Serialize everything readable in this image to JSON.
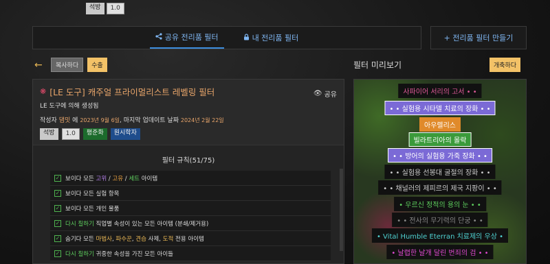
{
  "top_badges": [
    "석방",
    "1.0"
  ],
  "tabs": [
    {
      "icon": "share-icon",
      "glyph": "<",
      "label": "공유 전리품 필터"
    },
    {
      "icon": "lock-icon",
      "glyph": "🔒",
      "label": "내 전리품 필터"
    }
  ],
  "make_filter_label": "+ 전리품 필터 만들기",
  "toolbar": {
    "back_glyph": "←",
    "copy_label": "복사하다",
    "export_label": "수출"
  },
  "preview": {
    "title": "필터 미리보기",
    "collapse_label": "개축하다"
  },
  "filter": {
    "icon_glyph": "❋",
    "title": "[LE 도구] 캐주얼 프라이멀리스트 레벨링 필터",
    "share_glyph": "👁",
    "share_label": "공유",
    "subtitle": "LE 도구에 의해 생성됨",
    "meta": {
      "author_prefix": "작성자",
      "author": "댐밋",
      "on": "에",
      "created": "2023년 9월 6일",
      "updated_prefix": ", 마지막 업데이트 날짜",
      "updated": "2024년 2월 22일"
    },
    "tags": [
      "석방",
      "1.0",
      "평준화",
      "원시학자"
    ],
    "rules_title": "필터 규칙(51/75)",
    "check_glyph": "✓"
  },
  "rules": [
    {
      "parts": [
        {
          "t": "보이다 모든 ",
          "c": ""
        },
        {
          "t": "고위",
          "c": "c-purple"
        },
        {
          "t": " / ",
          "c": ""
        },
        {
          "t": "고유",
          "c": "c-orange"
        },
        {
          "t": " / ",
          "c": ""
        },
        {
          "t": "세트",
          "c": "c-green"
        },
        {
          "t": " 아이템",
          "c": ""
        }
      ]
    },
    {
      "parts": [
        {
          "t": "보이다 모든 실험 항목",
          "c": ""
        }
      ]
    },
    {
      "parts": [
        {
          "t": "보이다 모든 개인 물품",
          "c": ""
        }
      ]
    },
    {
      "parts": [
        {
          "t": "다시 칠하기",
          "c": "c-green"
        },
        {
          "t": " 직업별 속성이 있는 모든 아이템 (분쇄/제거용)",
          "c": ""
        }
      ]
    },
    {
      "parts": [
        {
          "t": "숨기다 모든 ",
          "c": ""
        },
        {
          "t": "마법사",
          "c": "c-gold"
        },
        {
          "t": ", ",
          "c": ""
        },
        {
          "t": "파수꾼",
          "c": "c-gold"
        },
        {
          "t": ", ",
          "c": ""
        },
        {
          "t": "견습",
          "c": "c-gold"
        },
        {
          "t": " 사제, ",
          "c": ""
        },
        {
          "t": "도적",
          "c": "c-gold"
        },
        {
          "t": " 전용 아이템",
          "c": ""
        }
      ]
    },
    {
      "parts": [
        {
          "t": "다시 칠하기",
          "c": "c-green"
        },
        {
          "t": " 귀중한 속성을 가진 모든 아이들",
          "c": ""
        }
      ]
    }
  ],
  "loot_labels": [
    {
      "text": "사파이어 서리의 고서 • •",
      "bg": "#111111",
      "color": "#e05a9a",
      "border": "#111111"
    },
    {
      "text": "• • 실험용 시타델 치료의 장화 • •",
      "bg": "#7b6ad6",
      "color": "#ffffff",
      "border": "#ffffff"
    },
    {
      "text": "아우렐리스",
      "bg": "#e08a2a",
      "color": "#ffffff",
      "border": "#e08a2a"
    },
    {
      "text": "빌라트리아의 몰락",
      "bg": "#3a9a3a",
      "color": "#ffffff",
      "border": "#ffffff"
    },
    {
      "text": "• • 방어의 실험용 가죽 장화 • •",
      "bg": "#7b6ad6",
      "color": "#ffffff",
      "border": "#ffffff"
    },
    {
      "text": "• • 실험용 선봉대 굴절의 장화 • •",
      "bg": "#111111",
      "color": "#cccccc",
      "border": "#111111"
    },
    {
      "text": "• • 채널러의 제피르의 제국 지팡이 • •",
      "bg": "#111111",
      "color": "#cccccc",
      "border": "#111111"
    },
    {
      "text": "• 우르신 정적의 용의 눈 • •",
      "bg": "#111111",
      "color": "#5fd15f",
      "border": "#111111"
    },
    {
      "text": "• • 전사의 무기력의 단궁 • •",
      "bg": "#111111",
      "color": "#888888",
      "border": "#111111"
    },
    {
      "text": "• Vital Humble Eterran 치료제의 우상 •",
      "bg": "#111111",
      "color": "#4fd1d1",
      "border": "#111111"
    },
    {
      "text": "• 날렵한 날개 달린 번죄의 검 • •",
      "bg": "#111111",
      "color": "#e04ad1",
      "border": "#111111"
    }
  ]
}
